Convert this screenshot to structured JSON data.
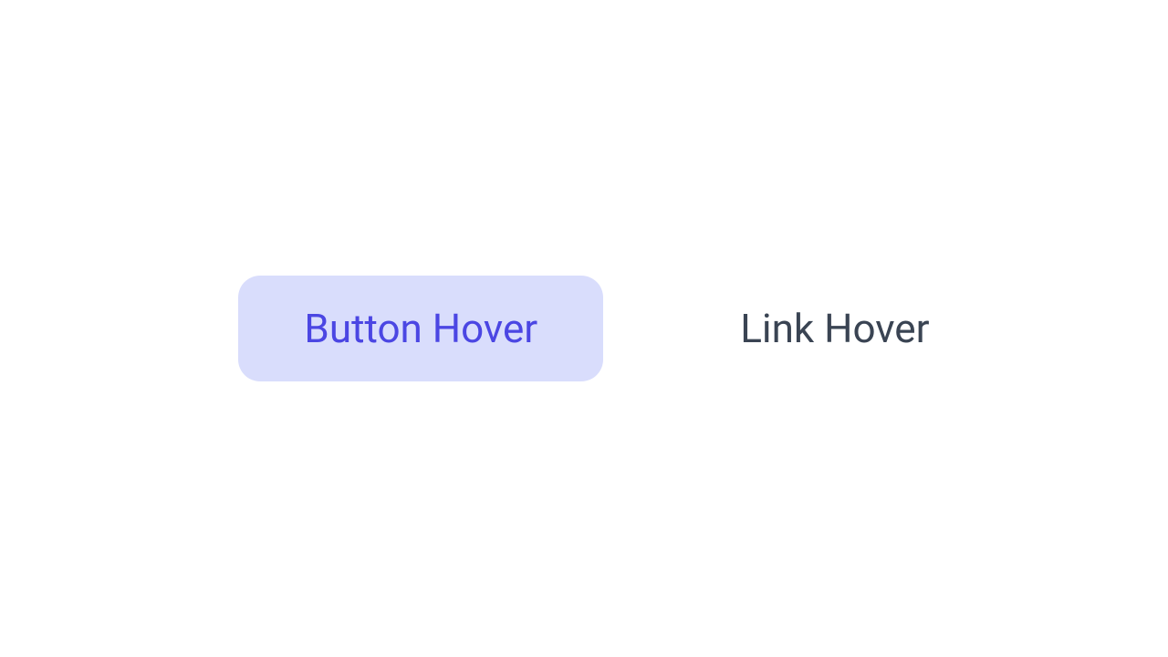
{
  "button": {
    "label": "Button Hover"
  },
  "link": {
    "label": "Link Hover"
  },
  "colors": {
    "button_bg": "#D9DDFC",
    "button_text": "#4B46E3",
    "link_text": "#3A4453"
  }
}
